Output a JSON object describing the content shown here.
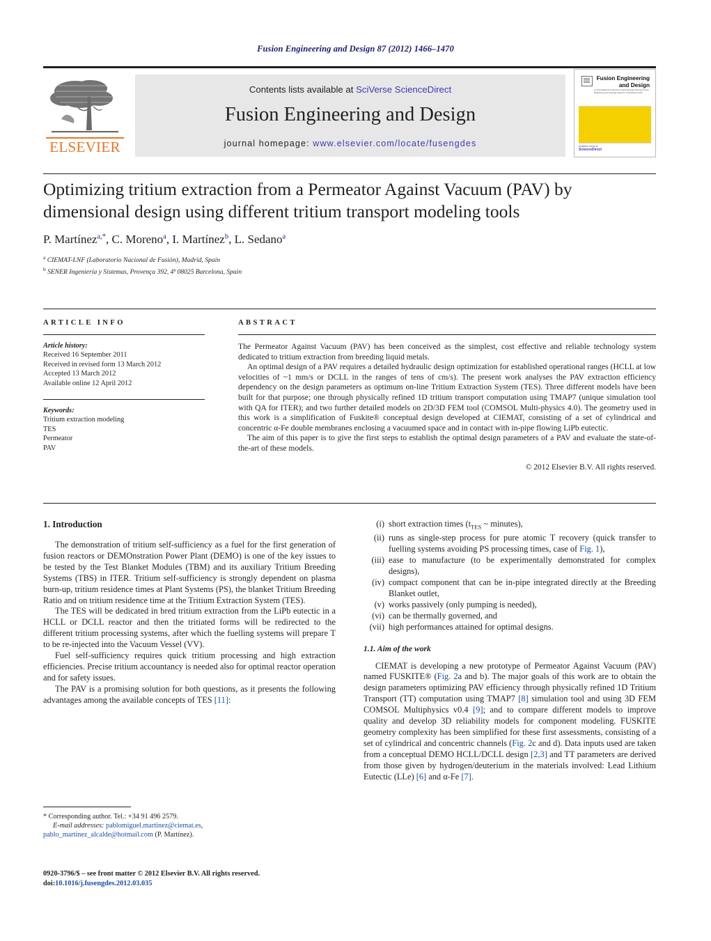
{
  "running_head": "Fusion Engineering and Design 87 (2012) 1466–1470",
  "masthead": {
    "contents_prefix": "Contents lists available at ",
    "contents_link": "SciVerse ScienceDirect",
    "journal_title": "Fusion Engineering and Design",
    "homepage_prefix": "journal homepage: ",
    "homepage_url": "www.elsevier.com/locate/fusengdes",
    "publisher": "ELSEVIER",
    "cover": {
      "title": "Fusion Engineering and Design",
      "subtitle": "An International Journal for Fusion Energy Devoted to the Engineering and Design Aspects of Nuclear Fusion",
      "footer": "Available online at",
      "footer_brand": "ScienceDirect",
      "yellow": "#F5D000"
    }
  },
  "article": {
    "title": "Optimizing tritium extraction from a Permeator Against Vacuum (PAV) by dimensional design using different tritium transport modeling tools",
    "authors": [
      {
        "name": "P. Martínez",
        "marks": "a,*"
      },
      {
        "name": "C. Moreno",
        "marks": "a"
      },
      {
        "name": "I. Martínez",
        "marks": "b"
      },
      {
        "name": "L. Sedano",
        "marks": "a"
      }
    ],
    "affiliations": [
      {
        "mark": "a",
        "text": "CIEMAT-LNF (Laboratorio Nacional de Fusión), Madrid, Spain"
      },
      {
        "mark": "b",
        "text": "SENER Ingeniería y Sistemas, Provença 392, 4ª 08025 Barcelona, Spain"
      }
    ]
  },
  "article_info": {
    "heading": "ARTICLE INFO",
    "history_label": "Article history:",
    "history": [
      "Received 16 September 2011",
      "Received in revised form 13 March 2012",
      "Accepted 13 March 2012",
      "Available online 12 April 2012"
    ],
    "keywords_label": "Keywords:",
    "keywords": [
      "Tritium extraction modeling",
      "TES",
      "Permeator",
      "PAV"
    ]
  },
  "abstract": {
    "heading": "ABSTRACT",
    "paragraphs": [
      "The Permeator Against Vacuum (PAV) has been conceived as the simplest, cost effective and reliable technology system dedicated to tritium extraction from breeding liquid metals.",
      "An optimal design of a PAV requires a detailed hydraulic design optimization for established operational ranges (HCLL at low velocities of ~1 mm/s or DCLL in the ranges of tens of cm/s). The present work analyses the PAV extraction efficiency dependency on the design parameters as optimum on-line Tritium Extraction System (TES). Three different models have been built for that purpose; one through physically refined 1D tritium transport computation using TMAP7 (unique simulation tool with QA for ITER); and two further detailed models on 2D/3D FEM tool (COMSOL Multi-physics 4.0). The geometry used in this work is a simplification of Fuskite® conceptual design developed at CIEMAT, consisting of a set of cylindrical and concentric α-Fe double membranes enclosing a vacuumed space and in contact with in-pipe flowing LiPb eutectic.",
      "The aim of this paper is to give the first steps to establish the optimal design parameters of a PAV and evaluate the state-of-the-art of these models."
    ],
    "copyright": "© 2012 Elsevier B.V. All rights reserved."
  },
  "body": {
    "section1_heading": "1.  Introduction",
    "left_paragraphs": [
      "The demonstration of tritium self-sufficiency as a fuel for the first generation of fusion reactors or DEMOnstration Power Plant (DEMO) is one of the key issues to be tested by the Test Blanket Modules (TBM) and its auxiliary Tritium Breeding Systems (TBS) in ITER. Tritium self-sufficiency is strongly dependent on plasma burn-up, tritium residence times at Plant Systems (PS), the blanket Tritium Breeding Ratio and on tritium residence time at the Tritium Extraction System (TES).",
      "The TES will be dedicated in bred tritium extraction from the LiPb eutectic in a HCLL or DCLL reactor and then the tritiated forms will be redirected to the different tritium processing systems, after which the fuelling systems will prepare T to be re-injected into the Vacuum Vessel (VV).",
      "Fuel self-sufficiency requires quick tritium processing and high extraction efficiencies. Precise tritium accountancy is needed also for optimal reactor operation and for safety issues."
    ],
    "left_last_paragraph": {
      "before": "The PAV is a promising solution for both questions, as it presents the following advantages among the available concepts of TES ",
      "ref": "[11]",
      "after": ":"
    },
    "advantages": [
      {
        "num": "(i)",
        "text": "short extraction times (tTES ~ minutes),",
        "sub_base": "short extraction times (t",
        "sub": "TES",
        "sub_tail": " ~ minutes),"
      },
      {
        "num": "(ii)",
        "text": "runs as single-step process for pure atomic T recovery (quick transfer to fuelling systems avoiding PS processing times, case of Fig. 1),",
        "ref": "Fig. 1"
      },
      {
        "num": "(iii)",
        "text": "ease to manufacture (to be experimentally demonstrated for complex designs),"
      },
      {
        "num": "(iv)",
        "text": "compact component that can be in-pipe integrated directly at the Breeding Blanket outlet,"
      },
      {
        "num": "(v)",
        "text": "works passively (only pumping is needed),"
      },
      {
        "num": "(vi)",
        "text": "can be thermally governed, and"
      },
      {
        "num": "(vii)",
        "text": "high performances attained for optimal designs."
      }
    ],
    "subsection_heading": "1.1.  Aim of the work",
    "aim_paragraph": {
      "p1": "CIEMAT is developing a new prototype of Permeator Against Vacuum (PAV) named FUSKITE® (",
      "r1": "Fig. 2",
      "p2": "a and b). The major goals of this work are to obtain the design parameters optimizing PAV efficiency through physically refined 1D Tritium Transport (TT) computation using TMAP7 ",
      "r2": "[8]",
      "p3": " simulation tool and using 3D FEM COMSOL Multiphysics v0.4 ",
      "r3": "[9]",
      "p4": "; and to compare different models to improve quality and develop 3D reliability models for component modeling. FUSKITE geometry complexity has been simplified for these first assessments, consisting of a set of cylindrical and concentric channels (",
      "r4": "Fig. 2",
      "p5": "c and d). Data inputs used are taken from a conceptual DEMO HCLL/DCLL design ",
      "r5": "[2,3]",
      "p6": " and TT parameters are derived from those given by hydrogen/deuterium in the materials involved: Lead Lithium Eutectic (LLe) ",
      "r6": "[6]",
      "p7": " and α-Fe ",
      "r7": "[7]",
      "p8": "."
    }
  },
  "footnotes": {
    "corresponding": "* Corresponding author. Tel.: +34 91 496 2579.",
    "email_label": "E-mail addresses:",
    "email1": "pablomiguel.martinez@ciemat.es",
    "email2": "pablo_martinez_alcalde@hotmail.com",
    "email_suffix": " (P. Martínez)."
  },
  "imprint": {
    "line1": "0920-3796/$ – see front matter © 2012 Elsevier B.V. All rights reserved.",
    "doi_label": "doi:",
    "doi": "10.1016/j.fusengdes.2012.03.035"
  }
}
